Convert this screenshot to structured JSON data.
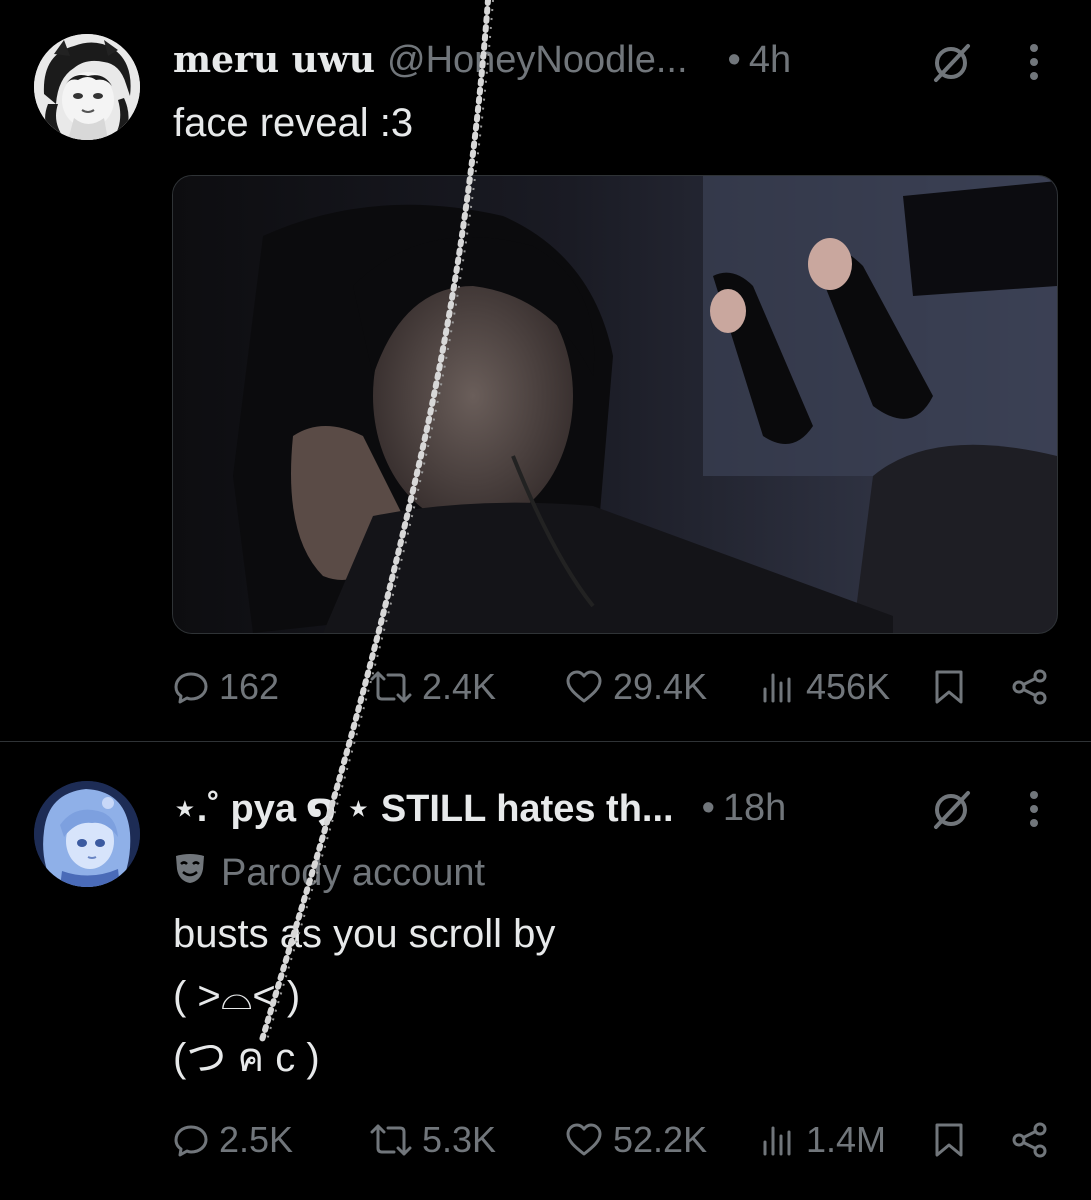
{
  "tweets": [
    {
      "display_name": "meru uwu",
      "handle": "@HoneyNoodle...",
      "dot": "•",
      "time": "4h",
      "text_lines": [
        "face reveal :3"
      ],
      "stats": {
        "replies": "162",
        "reposts": "2.4K",
        "likes": "29.4K",
        "views": "456K"
      }
    },
    {
      "display_name": "⋆.˚ pya ໑ ⋆ STILL hates th...",
      "handle": "",
      "dot": "•",
      "time": "18h",
      "badge_label": "Parody account",
      "text_lines": [
        "busts as you scroll by",
        "( >⌓< )",
        "(つ ค c )"
      ],
      "stats": {
        "replies": "2.5K",
        "reposts": "5.3K",
        "likes": "52.2K",
        "views": "1.4M"
      }
    }
  ],
  "icons": {
    "reply": "reply-icon",
    "repost": "repost-icon",
    "like": "heart-icon",
    "views": "views-icon",
    "bookmark": "bookmark-icon",
    "share": "share-icon",
    "grok": "grok-icon",
    "more": "more-icon",
    "parody": "mask-icon"
  },
  "colors": {
    "background": "#000000",
    "text_primary": "#e7e9ea",
    "text_secondary": "#71767b",
    "divider": "#2f3336"
  }
}
